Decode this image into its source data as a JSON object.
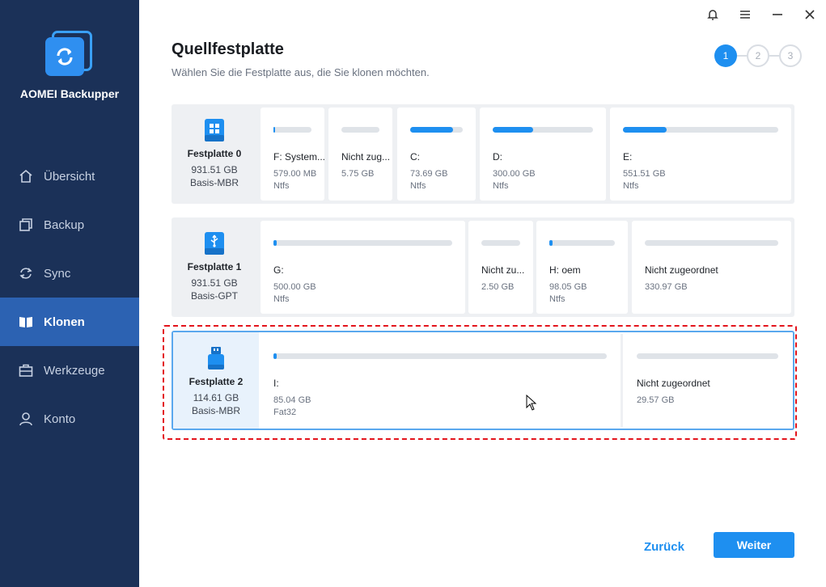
{
  "app": {
    "name": "AOMEI Backupper"
  },
  "nav": [
    {
      "label": "Übersicht",
      "icon": "home-icon"
    },
    {
      "label": "Backup",
      "icon": "backup-icon"
    },
    {
      "label": "Sync",
      "icon": "sync-icon"
    },
    {
      "label": "Klonen",
      "icon": "clone-icon",
      "active": true
    },
    {
      "label": "Werkzeuge",
      "icon": "tools-icon"
    },
    {
      "label": "Konto",
      "icon": "user-icon"
    }
  ],
  "header": {
    "title": "Quellfestplatte",
    "subtitle": "Wählen Sie die Festplatte aus, die Sie klonen möchten."
  },
  "steps": [
    "1",
    "2",
    "3"
  ],
  "disks": [
    {
      "name": "Festplatte 0",
      "size": "931.51 GB",
      "type": "Basis-MBR",
      "icon": "windows-disk-icon",
      "partitions": [
        {
          "name": "F: System...",
          "size": "579.00 MB",
          "fs": "Ntfs",
          "used": 0.05
        },
        {
          "name": "Nicht zug...",
          "size": "5.75 GB",
          "fs": "",
          "used": 0
        },
        {
          "name": "C:",
          "size": "73.69 GB",
          "fs": "Ntfs",
          "used": 0.8
        },
        {
          "name": "D:",
          "size": "300.00 GB",
          "fs": "Ntfs",
          "used": 0.4
        },
        {
          "name": "E:",
          "size": "551.51 GB",
          "fs": "Ntfs",
          "used": 0.28
        }
      ]
    },
    {
      "name": "Festplatte 1",
      "size": "931.51 GB",
      "type": "Basis-GPT",
      "icon": "usb-disk-icon",
      "partitions": [
        {
          "name": "G:",
          "size": "500.00 GB",
          "fs": "Ntfs",
          "used": 0.02
        },
        {
          "name": "Nicht zu...",
          "size": "2.50 GB",
          "fs": "",
          "used": 0
        },
        {
          "name": "H: oem",
          "size": "98.05 GB",
          "fs": "Ntfs",
          "used": 0.05
        },
        {
          "name": "Nicht zugeordnet",
          "size": "330.97 GB",
          "fs": "",
          "used": 0
        }
      ]
    },
    {
      "name": "Festplatte 2",
      "size": "114.61 GB",
      "type": "Basis-MBR",
      "icon": "usb-stick-icon",
      "selected": true,
      "partitions": [
        {
          "name": "I:",
          "size": "85.04 GB",
          "fs": "Fat32",
          "used": 0.01
        },
        {
          "name": "Nicht zugeordnet",
          "size": "29.57 GB",
          "fs": "",
          "used": 0
        }
      ]
    }
  ],
  "buttons": {
    "back": "Zurück",
    "next": "Weiter"
  },
  "colors": {
    "sidebar": "#1b3158",
    "accent": "#1e8ff0",
    "selection": "#e3141c"
  }
}
